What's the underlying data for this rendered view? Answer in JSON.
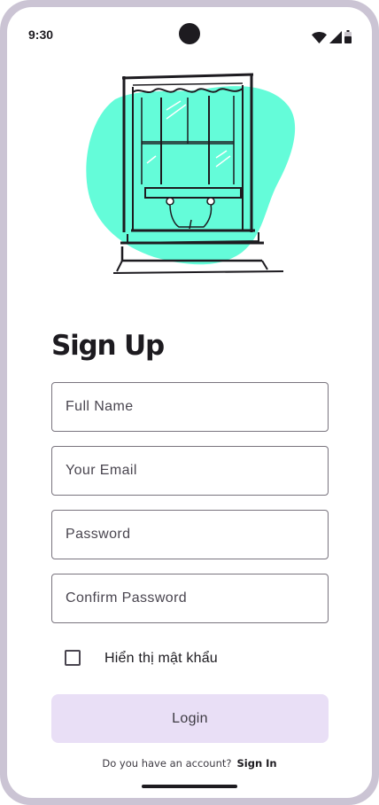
{
  "status_bar": {
    "time": "9:30"
  },
  "illustration": {
    "icon": "window-illustration",
    "accent_color": "#64fcd9"
  },
  "form": {
    "title": "Sign Up",
    "full_name_placeholder": "Full Name",
    "email_placeholder": "Your Email",
    "password_placeholder": "Password",
    "confirm_password_placeholder": "Confirm Password",
    "show_password_label": "Hiển thị mật khẩu",
    "show_password_checked": false,
    "submit_label": "Login",
    "submit_color": "#e9dff6"
  },
  "footer": {
    "prompt": "Do you have an account?",
    "link_label": "Sign In"
  }
}
